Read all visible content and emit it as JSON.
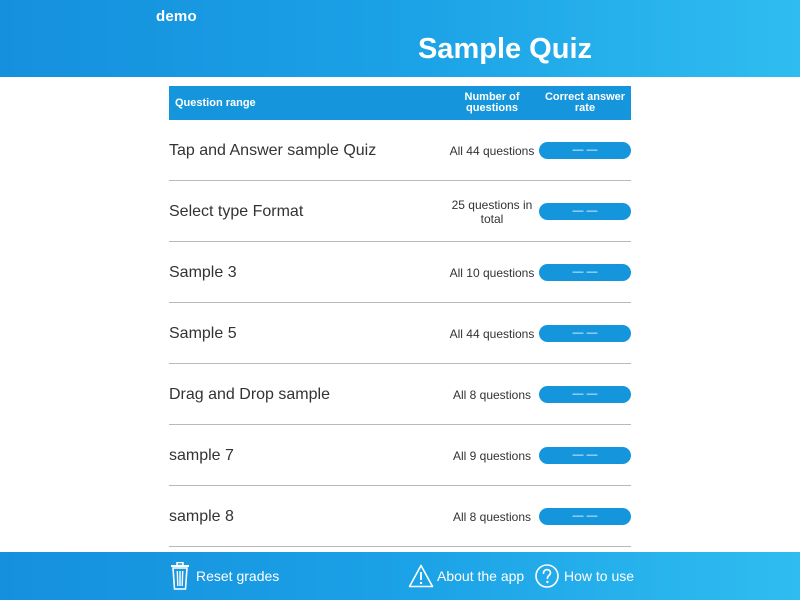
{
  "header": {
    "app_name": "demo",
    "title": "Sample Quiz"
  },
  "table": {
    "headers": {
      "range": "Question range",
      "count_line1": "Number of",
      "count_line2": "questions",
      "rate_line1": "Correct answer",
      "rate_line2": "rate"
    },
    "rows": [
      {
        "name": "Tap and Answer sample Quiz",
        "count_line1": "All 44 questions",
        "count_line2": "",
        "rate": "— —"
      },
      {
        "name": "Select type Format",
        "count_line1": "25 questions in",
        "count_line2": "total",
        "rate": "— —"
      },
      {
        "name": "Sample 3",
        "count_line1": "All 10 questions",
        "count_line2": "",
        "rate": "— —"
      },
      {
        "name": "Sample 5",
        "count_line1": "All 44 questions",
        "count_line2": "",
        "rate": "— —"
      },
      {
        "name": "Drag and Drop sample",
        "count_line1": "All 8 questions",
        "count_line2": "",
        "rate": "— —"
      },
      {
        "name": "sample 7",
        "count_line1": "All 9 questions",
        "count_line2": "",
        "rate": "— —"
      },
      {
        "name": "sample 8",
        "count_line1": "All 8 questions",
        "count_line2": "",
        "rate": "— —"
      }
    ]
  },
  "footer": {
    "reset_label": "Reset grades",
    "reset_icon": "trash-icon",
    "about_label": "About the app",
    "about_icon": "warning-icon",
    "howto_label": "How to use",
    "howto_icon": "question-icon"
  },
  "colors": {
    "header_gradient_start": "#1590dd",
    "header_gradient_end": "#2fbdf0",
    "accent": "#1596dc",
    "divider": "#b9b9b9"
  }
}
